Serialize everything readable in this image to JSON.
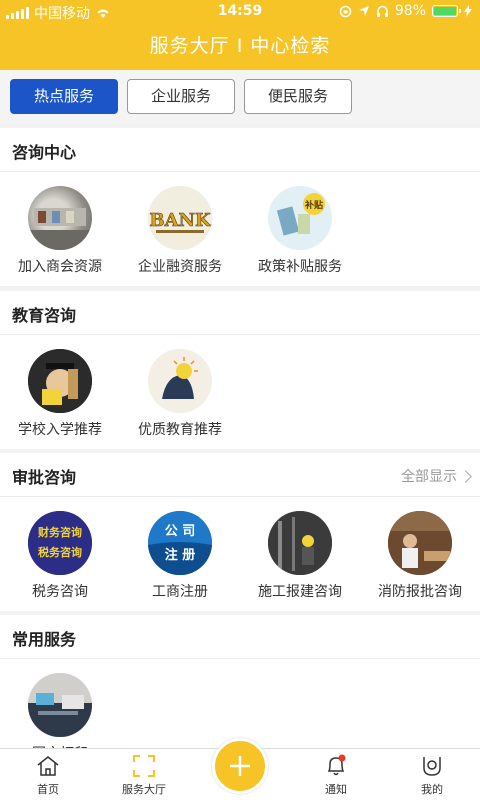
{
  "status": {
    "carrier": "中国移动",
    "time": "14:59",
    "battery": "98%",
    "battery_level": 0.98
  },
  "nav": {
    "title": "服务大厅 I 中心检索"
  },
  "tabs": [
    {
      "label": "热点服务",
      "active": true
    },
    {
      "label": "企业服务",
      "active": false
    },
    {
      "label": "便民服务",
      "active": false
    }
  ],
  "sections": [
    {
      "title": "咨询中心",
      "items": [
        "加入商会资源",
        "企业融资服务",
        "政策补贴服务"
      ]
    },
    {
      "title": "教育咨询",
      "items": [
        "学校入学推荐",
        "优质教育推荐"
      ]
    },
    {
      "title": "审批咨询",
      "show_all": "全部显示",
      "items": [
        "税务咨询",
        "工商注册",
        "施工报建咨询",
        "消防报批咨询"
      ]
    },
    {
      "title": "常用服务",
      "items": [
        "图文打印"
      ]
    }
  ],
  "thumb_text": {
    "bank": "BANK",
    "subsidy": "补贴",
    "tax1": "财务咨询",
    "tax2": "税务咨询",
    "reg1": "公 司",
    "reg2": "注 册"
  },
  "bottom_tabs": [
    {
      "label": "首页",
      "icon": "home-icon"
    },
    {
      "label": "服务大厅",
      "icon": "scan-frame-icon"
    },
    {
      "label": "通知",
      "icon": "bell-icon"
    },
    {
      "label": "我的",
      "icon": "user-icon"
    }
  ],
  "colors": {
    "primary": "#f6c427",
    "active_tab": "#1b55c8"
  }
}
